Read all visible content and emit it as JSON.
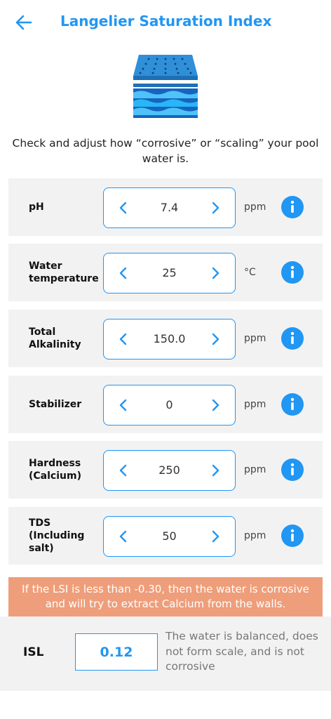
{
  "header": {
    "title": "Langelier Saturation Index"
  },
  "intro": "Check and adjust how “corrosive” or “scaling” your pool water is.",
  "parameters": [
    {
      "label": "pH",
      "value": "7.4",
      "unit": "ppm"
    },
    {
      "label": "Water temperature",
      "value": "25",
      "unit": "°C"
    },
    {
      "label": "Total Alkalinity",
      "value": "150.0",
      "unit": "ppm"
    },
    {
      "label": "Stabilizer",
      "value": "0",
      "unit": "ppm"
    },
    {
      "label": "Hardness (Calcium)",
      "value": "250",
      "unit": "ppm"
    },
    {
      "label": "TDS (Including salt)",
      "value": "50",
      "unit": "ppm"
    }
  ],
  "warning": "If the LSI is less than -0.30, then the water is corrosive and will try to extract Calcium from the walls.",
  "result": {
    "label": "ISL",
    "value": "0.12",
    "description": "The water is balanced, does not form scale, and is not corrosive"
  },
  "colors": {
    "accent": "#2196f3",
    "warning": "#ee9e7a",
    "row_background": "#f2f2f2"
  }
}
